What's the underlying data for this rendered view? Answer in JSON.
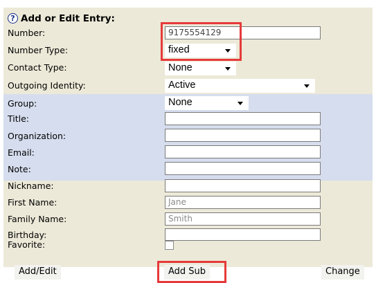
{
  "form": {
    "header": "Add or Edit Entry:",
    "help_symbol": "?",
    "labels": {
      "number": "Number:",
      "number_type": "Number Type:",
      "contact_type": "Contact Type:",
      "outgoing_identity": "Outgoing Identity:",
      "group": "Group:",
      "title": "Title:",
      "organization": "Organization:",
      "email": "Email:",
      "note": "Note:",
      "nickname": "Nickname:",
      "first_name": "First Name:",
      "family_name": "Family Name:",
      "birthday": "Birthday:",
      "favorite": "Favorite:"
    },
    "values": {
      "number": "9175554129",
      "number_type": "fixed",
      "contact_type": "None",
      "outgoing_identity": "Active",
      "group": "None",
      "title": "",
      "organization": "",
      "email": "",
      "note": "",
      "nickname": "",
      "first_name": "Jane",
      "family_name": "Smith",
      "birthday": "",
      "favorite": false
    }
  },
  "buttons": {
    "add_edit": "Add/Edit",
    "add_sub": "Add Sub",
    "change": "Change"
  },
  "colors": {
    "panel": "#ece9d8",
    "group_band": "#d6ddee",
    "highlight": "#e63a3a"
  }
}
